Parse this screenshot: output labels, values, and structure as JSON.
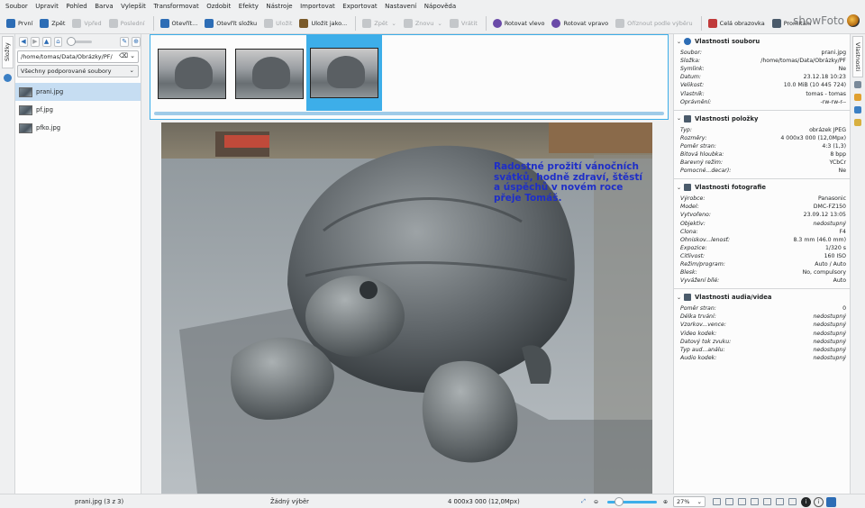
{
  "menu": [
    "Soubor",
    "Upravit",
    "Pohled",
    "Barva",
    "Vylepšit",
    "Transformovat",
    "Ozdobit",
    "Efekty",
    "Nástroje",
    "Importovat",
    "Exportovat",
    "Nastavení",
    "Nápověda"
  ],
  "toolbar": {
    "first": "První",
    "back": "Zpět",
    "forward": "Vpřed",
    "last": "Poslední",
    "open": "Otevřít...",
    "open_folder": "Otevřít složku",
    "save": "Uložit",
    "save_as": "Uložit jako...",
    "undo": "Zpět",
    "redo": "Znovu",
    "revert": "Vrátit",
    "rotate_left": "Rotovat vlevo",
    "rotate_right": "Rotovat vpravo",
    "crop": "Oříznout podle výběru",
    "fullscreen": "Celá obrazovka",
    "slideshow": "Promítání"
  },
  "app_name": "showFoto",
  "left_tab": "Složky",
  "left_panel": {
    "path": "/home/tomas/Data/Obrázky/PF/",
    "filter": "Všechny podporované soubory",
    "files": [
      {
        "name": "prani.jpg",
        "selected": true
      },
      {
        "name": "pf.jpg",
        "selected": false
      },
      {
        "name": "pfko.jpg",
        "selected": false
      }
    ]
  },
  "photo_overlay_text": "Radostné prožití vánočních svátků, hodně zdraví, štěstí a úspěchů v novém roce přeje Tomáš.",
  "right_tab": "Vlastnosti",
  "file_props": {
    "title": "Vlastnosti souboru",
    "rows": [
      {
        "k": "Soubor:",
        "v": "prani.jpg"
      },
      {
        "k": "Složka:",
        "v": "/home/tomas/Data/Obrázky/PF"
      },
      {
        "k": "Symlink:",
        "v": "Ne"
      },
      {
        "k": "Datum:",
        "v": "23.12.18 10:23"
      },
      {
        "k": "Velikost:",
        "v": "10.0 MiB (10 445 724)"
      },
      {
        "k": "Vlastník:",
        "v": "tomas - tomas"
      },
      {
        "k": "Oprávnění:",
        "v": "-rw-rw-r--"
      }
    ]
  },
  "item_props": {
    "title": "Vlastnosti položky",
    "rows": [
      {
        "k": "Typ:",
        "v": "obrázek JPEG"
      },
      {
        "k": "Rozměry:",
        "v": "4 000x3 000 (12,0Mpx)"
      },
      {
        "k": "Poměr stran:",
        "v": "4:3 (1,3)"
      },
      {
        "k": "Bitová hloubka:",
        "v": "8 bpp"
      },
      {
        "k": "Barevný režim:",
        "v": "YCbCr"
      },
      {
        "k": "Pomocné...decar):",
        "v": "Ne"
      }
    ]
  },
  "photo_props": {
    "title": "Vlastnosti fotografie",
    "rows": [
      {
        "k": "Výrobce:",
        "v": "Panasonic"
      },
      {
        "k": "Model:",
        "v": "DMC-FZ150"
      },
      {
        "k": "Vytvořeno:",
        "v": "23.09.12 13:05"
      },
      {
        "k": "Objektiv:",
        "v": "nedostupný"
      },
      {
        "k": "Clona:",
        "v": "F4"
      },
      {
        "k": "Ohniskov...lenosť:",
        "v": "8.3 mm (46.0 mm)"
      },
      {
        "k": "Expozice:",
        "v": "1/320 s"
      },
      {
        "k": "Citlivost:",
        "v": "160 ISO"
      },
      {
        "k": "Režim/program:",
        "v": "Auto / Auto"
      },
      {
        "k": "Blesk:",
        "v": "No, compulsory"
      },
      {
        "k": "Vyvážení bílé:",
        "v": "Auto"
      }
    ]
  },
  "av_props": {
    "title": "Vlastnosti audia/videa",
    "rows": [
      {
        "k": "Poměr stran:",
        "v": "0"
      },
      {
        "k": "Délka trvání:",
        "v": "nedostupný"
      },
      {
        "k": "Vzorkov...vence:",
        "v": "nedostupný"
      },
      {
        "k": "Video kodek:",
        "v": "nedostupný"
      },
      {
        "k": "Datový tok zvuku:",
        "v": "nedostupný"
      },
      {
        "k": "Typ aud...análu:",
        "v": "nedostupný"
      },
      {
        "k": "Audio kodek:",
        "v": "nedostupný"
      }
    ]
  },
  "status": {
    "file_info": "prani.jpg (3 z 3)",
    "selection": "Žádný výběr",
    "dimensions": "4 000x3 000 (12,0Mpx)",
    "zoom": "27%"
  },
  "colors": {
    "accent": "#3daee9",
    "overlay_text": "#1e2ec8",
    "selected_row": "#c6ddf2"
  }
}
